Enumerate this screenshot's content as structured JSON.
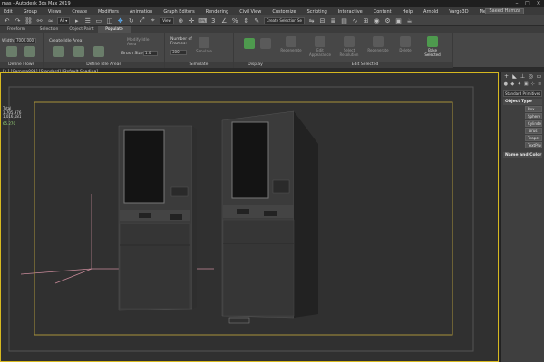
{
  "window": {
    "title": "mas - Autodesk 3ds Max 2019",
    "controls": [
      "–",
      "□",
      "×"
    ]
  },
  "menu": {
    "items": [
      "Edit",
      "Group",
      "Views",
      "Create",
      "Modifiers",
      "Animation",
      "Graph Editors",
      "Rendering",
      "Civil View",
      "Customize",
      "Scripting",
      "Interactive",
      "Content",
      "Help",
      "Arnold",
      "Vargo3D",
      "Megascans"
    ],
    "user": "Saeed Hamza"
  },
  "toolbar": {
    "view_dropdown": "View",
    "selection_set": "Create Selection Se"
  },
  "ribbon_tabs": [
    "Freeform",
    "Selection",
    "Object Paint",
    "Populate"
  ],
  "ribbon": {
    "flows": {
      "width_label": "Width:",
      "width_value": "7000.000",
      "caption": "Define Flows"
    },
    "idle": {
      "create_label": "Create Idle Area:",
      "brush_label": "Brush Size:",
      "brush_value": "1.0",
      "modify_label": "Modify Idle Area",
      "caption": "Define Idle Areas"
    },
    "simulate": {
      "frames_label": "Number of Frames:",
      "frames_value": "300",
      "simulate_label": "Simulate",
      "caption": "Simulate"
    },
    "display": {
      "caption": "Display"
    },
    "edit": {
      "buttons": [
        "Regenerate",
        "Edit Appearance",
        "Select Resolution",
        "Regenerate",
        "Delete",
        "Bake Selected"
      ],
      "caption": "Edit Selected"
    }
  },
  "viewport": {
    "label": "[+] [Camera001] [Standard] [Default Shading]",
    "stats": {
      "title": "Total",
      "line1": "1,705,976",
      "line2": "1,016,181",
      "fps": "65.270"
    }
  },
  "command_panel": {
    "dropdown": "Standard Primitives",
    "rollout_object_type": "Object Type",
    "buttons": [
      "Box",
      "Sphere",
      "Cylinder",
      "Torus",
      "Teapot",
      "TextPlus"
    ],
    "rollout_name_color": "Name and Color"
  },
  "colors": {
    "selection_border": "#d6b820",
    "safe_frame": "#a8923a",
    "active_tool": "#5db4ff"
  }
}
